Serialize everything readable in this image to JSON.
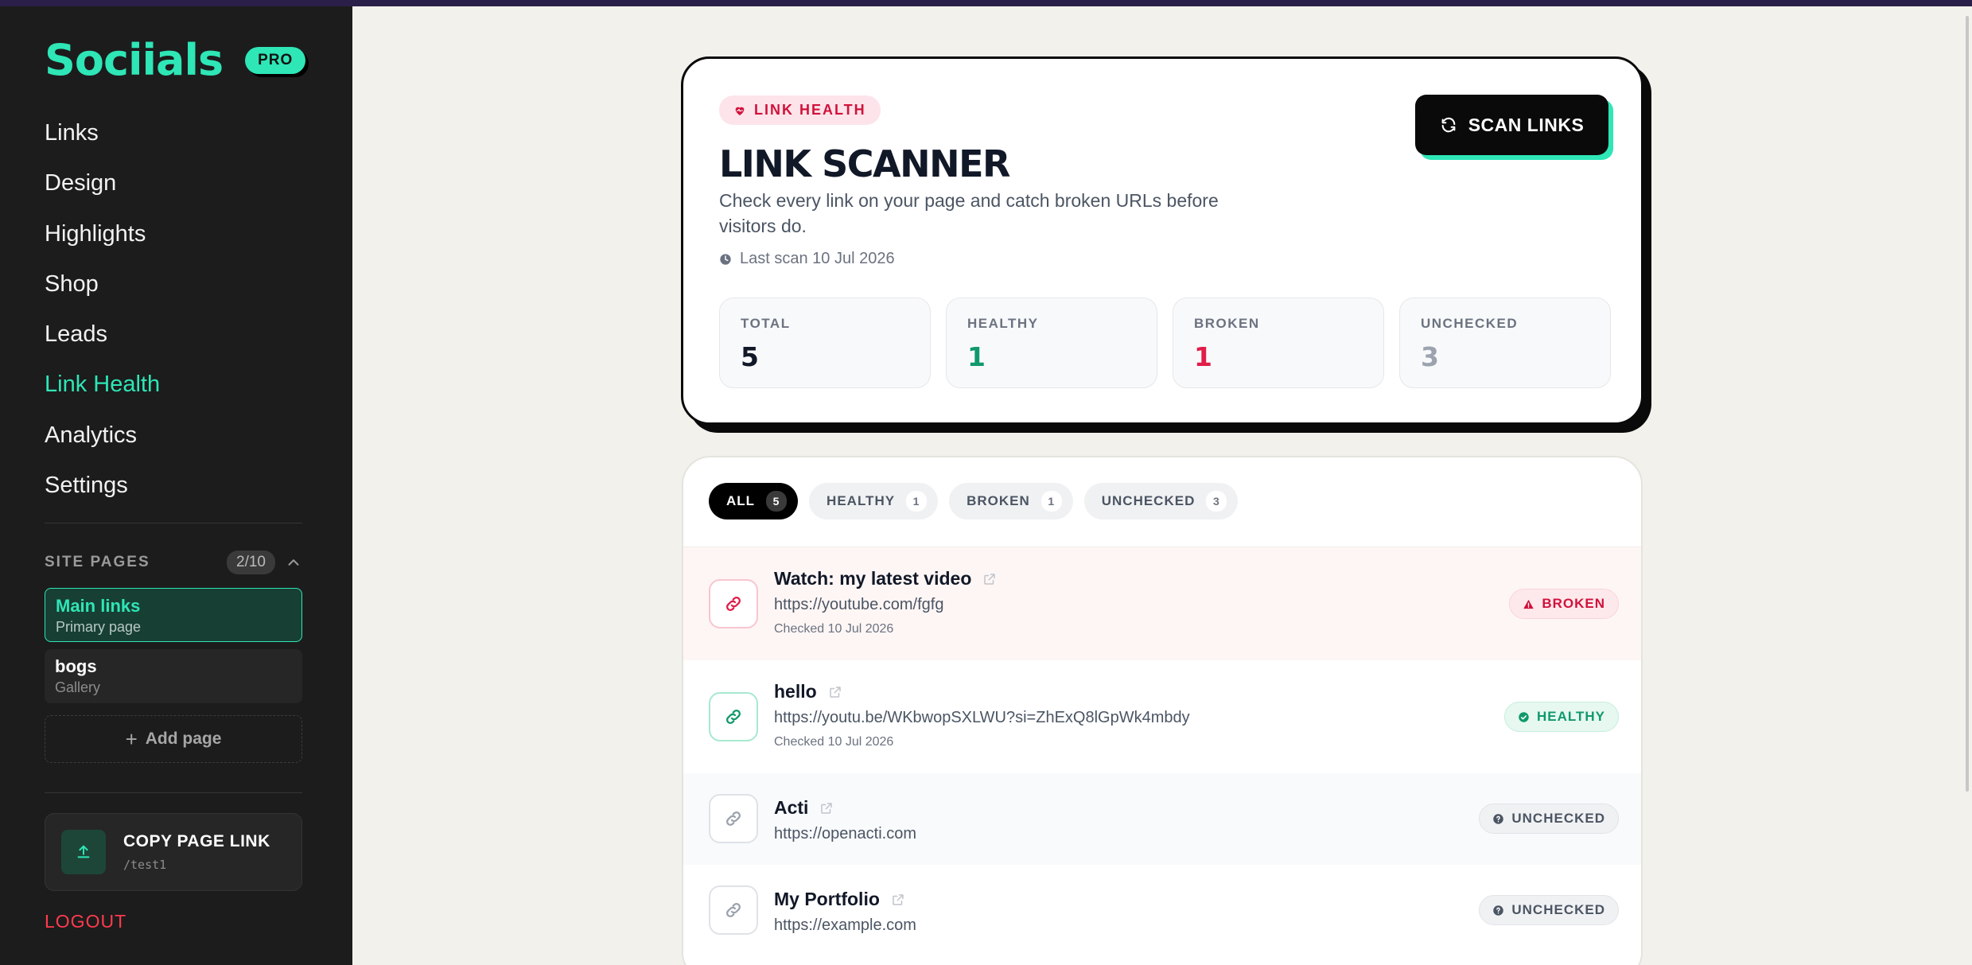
{
  "sidebar": {
    "brand": "Sociials",
    "pro_badge": "PRO",
    "nav": [
      "Links",
      "Design",
      "Highlights",
      "Shop",
      "Leads",
      "Link Health",
      "Analytics",
      "Settings"
    ],
    "active_nav": "Link Health",
    "site_pages": {
      "label": "SITE PAGES",
      "count": "2/10",
      "pages": [
        {
          "title": "Main links",
          "subtitle": "Primary page"
        },
        {
          "title": "bogs",
          "subtitle": "Gallery"
        }
      ],
      "add_label": "Add page"
    },
    "copy_link": {
      "title": "COPY PAGE LINK",
      "path": "/test1"
    },
    "logout": "LOGOUT"
  },
  "scanner": {
    "badge": "LINK HEALTH",
    "title": "LINK SCANNER",
    "description": "Check every link on your page and catch broken URLs before visitors do.",
    "last_scan": "Last scan 10 Jul 2026",
    "scan_button": "SCAN LINKS",
    "stats": [
      {
        "label": "TOTAL",
        "value": "5",
        "color": "#111827"
      },
      {
        "label": "HEALTHY",
        "value": "1",
        "color": "#10996b"
      },
      {
        "label": "BROKEN",
        "value": "1",
        "color": "#e11d48"
      },
      {
        "label": "UNCHECKED",
        "value": "3",
        "color": "#9ca3af"
      }
    ]
  },
  "filters": [
    {
      "label": "ALL",
      "count": "5"
    },
    {
      "label": "HEALTHY",
      "count": "1"
    },
    {
      "label": "BROKEN",
      "count": "1"
    },
    {
      "label": "UNCHECKED",
      "count": "3"
    }
  ],
  "links": [
    {
      "name": "Watch: my latest video",
      "url": "https://youtube.com/fgfg",
      "checked": "Checked 10 Jul 2026",
      "status": "BROKEN"
    },
    {
      "name": "hello",
      "url": "https://youtu.be/WKbwopSXLWU?si=ZhExQ8lGpWk4mbdy",
      "checked": "Checked 10 Jul 2026",
      "status": "HEALTHY"
    },
    {
      "name": "Acti",
      "url": "https://openacti.com",
      "checked": "",
      "status": "UNCHECKED"
    },
    {
      "name": "My Portfolio",
      "url": "https://example.com",
      "checked": "",
      "status": "UNCHECKED"
    }
  ],
  "colors": {
    "accent": "#2ee6b6",
    "broken": "#e11d48",
    "healthy": "#10996b",
    "unchecked": "#4b5563"
  }
}
